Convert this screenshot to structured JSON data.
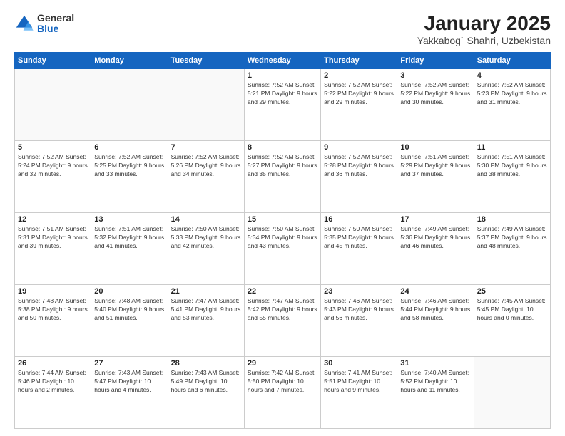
{
  "logo": {
    "general": "General",
    "blue": "Blue"
  },
  "title": {
    "main": "January 2025",
    "sub": "Yakkabog` Shahri, Uzbekistan"
  },
  "weekdays": [
    "Sunday",
    "Monday",
    "Tuesday",
    "Wednesday",
    "Thursday",
    "Friday",
    "Saturday"
  ],
  "weeks": [
    [
      {
        "day": "",
        "info": ""
      },
      {
        "day": "",
        "info": ""
      },
      {
        "day": "",
        "info": ""
      },
      {
        "day": "1",
        "info": "Sunrise: 7:52 AM\nSunset: 5:21 PM\nDaylight: 9 hours\nand 29 minutes."
      },
      {
        "day": "2",
        "info": "Sunrise: 7:52 AM\nSunset: 5:22 PM\nDaylight: 9 hours\nand 29 minutes."
      },
      {
        "day": "3",
        "info": "Sunrise: 7:52 AM\nSunset: 5:22 PM\nDaylight: 9 hours\nand 30 minutes."
      },
      {
        "day": "4",
        "info": "Sunrise: 7:52 AM\nSunset: 5:23 PM\nDaylight: 9 hours\nand 31 minutes."
      }
    ],
    [
      {
        "day": "5",
        "info": "Sunrise: 7:52 AM\nSunset: 5:24 PM\nDaylight: 9 hours\nand 32 minutes."
      },
      {
        "day": "6",
        "info": "Sunrise: 7:52 AM\nSunset: 5:25 PM\nDaylight: 9 hours\nand 33 minutes."
      },
      {
        "day": "7",
        "info": "Sunrise: 7:52 AM\nSunset: 5:26 PM\nDaylight: 9 hours\nand 34 minutes."
      },
      {
        "day": "8",
        "info": "Sunrise: 7:52 AM\nSunset: 5:27 PM\nDaylight: 9 hours\nand 35 minutes."
      },
      {
        "day": "9",
        "info": "Sunrise: 7:52 AM\nSunset: 5:28 PM\nDaylight: 9 hours\nand 36 minutes."
      },
      {
        "day": "10",
        "info": "Sunrise: 7:51 AM\nSunset: 5:29 PM\nDaylight: 9 hours\nand 37 minutes."
      },
      {
        "day": "11",
        "info": "Sunrise: 7:51 AM\nSunset: 5:30 PM\nDaylight: 9 hours\nand 38 minutes."
      }
    ],
    [
      {
        "day": "12",
        "info": "Sunrise: 7:51 AM\nSunset: 5:31 PM\nDaylight: 9 hours\nand 39 minutes."
      },
      {
        "day": "13",
        "info": "Sunrise: 7:51 AM\nSunset: 5:32 PM\nDaylight: 9 hours\nand 41 minutes."
      },
      {
        "day": "14",
        "info": "Sunrise: 7:50 AM\nSunset: 5:33 PM\nDaylight: 9 hours\nand 42 minutes."
      },
      {
        "day": "15",
        "info": "Sunrise: 7:50 AM\nSunset: 5:34 PM\nDaylight: 9 hours\nand 43 minutes."
      },
      {
        "day": "16",
        "info": "Sunrise: 7:50 AM\nSunset: 5:35 PM\nDaylight: 9 hours\nand 45 minutes."
      },
      {
        "day": "17",
        "info": "Sunrise: 7:49 AM\nSunset: 5:36 PM\nDaylight: 9 hours\nand 46 minutes."
      },
      {
        "day": "18",
        "info": "Sunrise: 7:49 AM\nSunset: 5:37 PM\nDaylight: 9 hours\nand 48 minutes."
      }
    ],
    [
      {
        "day": "19",
        "info": "Sunrise: 7:48 AM\nSunset: 5:38 PM\nDaylight: 9 hours\nand 50 minutes."
      },
      {
        "day": "20",
        "info": "Sunrise: 7:48 AM\nSunset: 5:40 PM\nDaylight: 9 hours\nand 51 minutes."
      },
      {
        "day": "21",
        "info": "Sunrise: 7:47 AM\nSunset: 5:41 PM\nDaylight: 9 hours\nand 53 minutes."
      },
      {
        "day": "22",
        "info": "Sunrise: 7:47 AM\nSunset: 5:42 PM\nDaylight: 9 hours\nand 55 minutes."
      },
      {
        "day": "23",
        "info": "Sunrise: 7:46 AM\nSunset: 5:43 PM\nDaylight: 9 hours\nand 56 minutes."
      },
      {
        "day": "24",
        "info": "Sunrise: 7:46 AM\nSunset: 5:44 PM\nDaylight: 9 hours\nand 58 minutes."
      },
      {
        "day": "25",
        "info": "Sunrise: 7:45 AM\nSunset: 5:45 PM\nDaylight: 10 hours\nand 0 minutes."
      }
    ],
    [
      {
        "day": "26",
        "info": "Sunrise: 7:44 AM\nSunset: 5:46 PM\nDaylight: 10 hours\nand 2 minutes."
      },
      {
        "day": "27",
        "info": "Sunrise: 7:43 AM\nSunset: 5:47 PM\nDaylight: 10 hours\nand 4 minutes."
      },
      {
        "day": "28",
        "info": "Sunrise: 7:43 AM\nSunset: 5:49 PM\nDaylight: 10 hours\nand 6 minutes."
      },
      {
        "day": "29",
        "info": "Sunrise: 7:42 AM\nSunset: 5:50 PM\nDaylight: 10 hours\nand 7 minutes."
      },
      {
        "day": "30",
        "info": "Sunrise: 7:41 AM\nSunset: 5:51 PM\nDaylight: 10 hours\nand 9 minutes."
      },
      {
        "day": "31",
        "info": "Sunrise: 7:40 AM\nSunset: 5:52 PM\nDaylight: 10 hours\nand 11 minutes."
      },
      {
        "day": "",
        "info": ""
      }
    ]
  ]
}
